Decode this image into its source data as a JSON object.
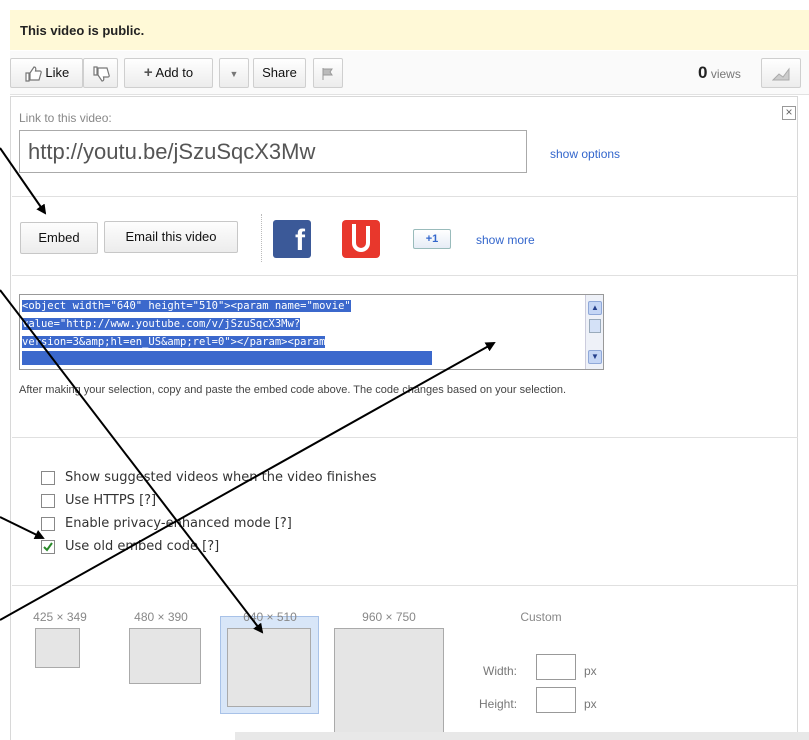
{
  "notice": "This video is public.",
  "toolbar": {
    "like": "Like",
    "add_to": "Add to",
    "share": "Share",
    "views_count": "0",
    "views_label": "views"
  },
  "link_section": {
    "label": "Link to this video:",
    "url": "http://youtu.be/jSzuSqcX3Mw",
    "show_options": "show options",
    "close": "×"
  },
  "share_row": {
    "embed": "Embed",
    "email": "Email this video",
    "gplus": "+1",
    "show_more": "show more"
  },
  "embed": {
    "code_lines": [
      "<object width=\"640\" height=\"510\"><param name=\"movie\"",
      "value=\"http://www.youtube.com/v/jSzuSqcX3Mw?",
      "version=3&amp;hl=en_US&amp;rel=0\"></param><param"
    ],
    "help_text": "After making your selection, copy and paste the embed code above. The code changes based on your selection."
  },
  "options": [
    {
      "label": "Show suggested videos when the video finishes",
      "checked": false
    },
    {
      "label": "Use HTTPS [?]",
      "checked": false
    },
    {
      "label": "Enable privacy-enhanced mode [?]",
      "checked": false
    },
    {
      "label": "Use old embed code [?]",
      "checked": true
    }
  ],
  "sizes": [
    {
      "label": "425 × 349",
      "selected": false
    },
    {
      "label": "480 × 390",
      "selected": false
    },
    {
      "label": "640 × 510",
      "selected": true
    },
    {
      "label": "960 × 750",
      "selected": false
    }
  ],
  "custom": {
    "title": "Custom",
    "width_label": "Width:",
    "height_label": "Height:",
    "unit": "px"
  },
  "colors": {
    "notice_bg": "#fff9d7",
    "link": "#3366cc",
    "selection": "#3b68cc",
    "facebook": "#3b5998",
    "blogger_red": "#e8372c"
  }
}
